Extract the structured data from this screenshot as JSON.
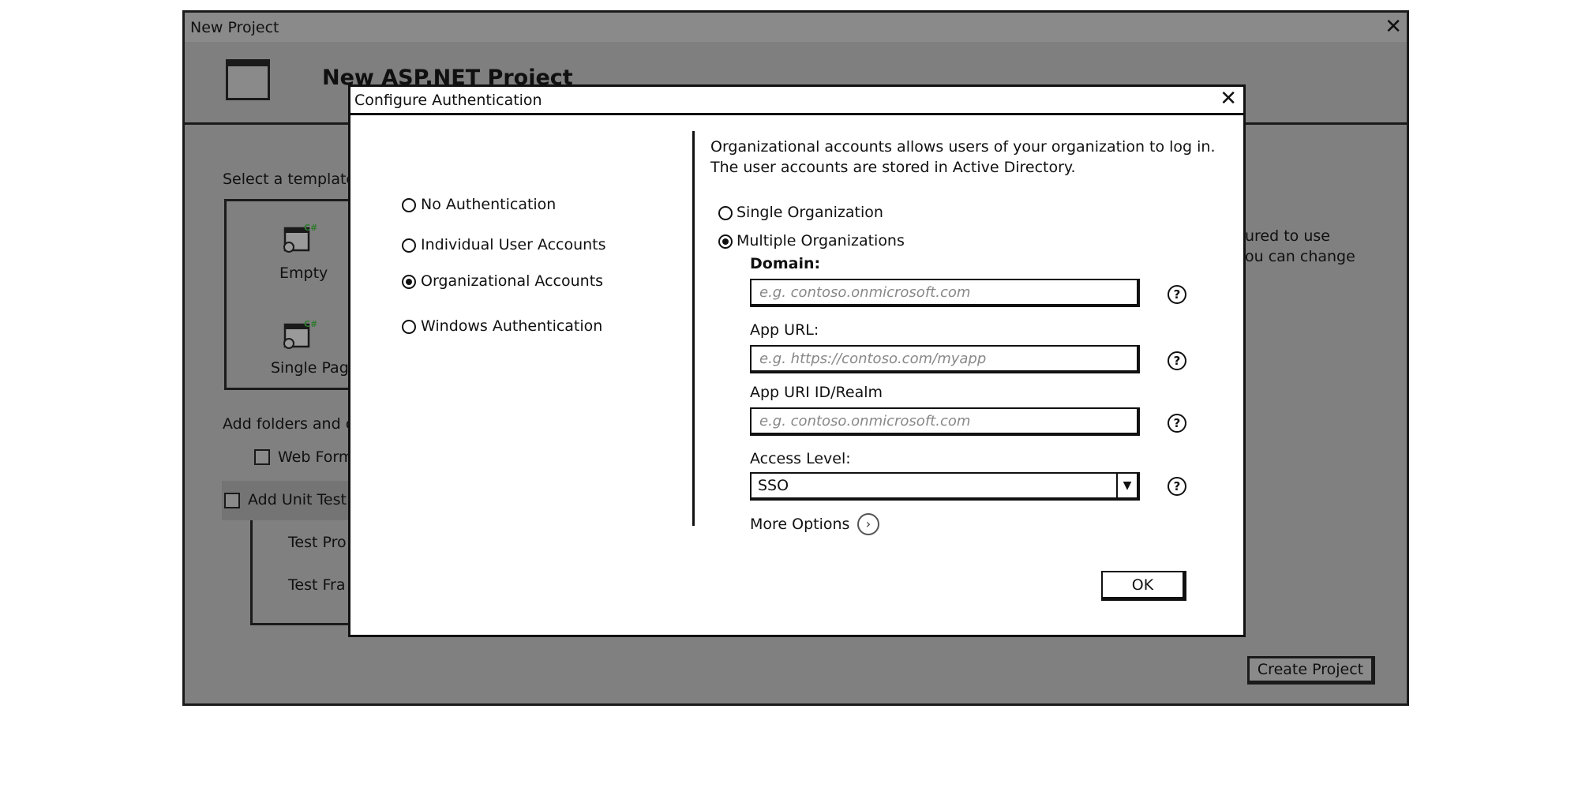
{
  "background_window": {
    "title": "New Project",
    "close_glyph": "✕",
    "header_title": "New ASP.NET Project",
    "select_template_label": "Select a template",
    "templates": [
      {
        "label": "Empty",
        "badge": "C#"
      },
      {
        "label": "Single Pag",
        "badge": "C#"
      }
    ],
    "add_folders_label": "Add folders and c",
    "web_forms_label": "Web Form",
    "add_unit_tests_label": "Add Unit Test",
    "test_project_label": "Test Pro",
    "test_framework_label": "Test Fra",
    "auth_note_line1": "ured to use",
    "auth_note_line2": "ou can change",
    "create_project_label": "Create Project"
  },
  "dialog": {
    "title": "Configure Authentication",
    "close_glyph": "✕",
    "auth_options": [
      {
        "label": "No Authentication",
        "selected": false
      },
      {
        "label": "Individual User Accounts",
        "selected": false
      },
      {
        "label": "Organizational Accounts",
        "selected": true
      },
      {
        "label": "Windows Authentication",
        "selected": false
      }
    ],
    "description_line1": "Organizational accounts allows users of your organization to log in.",
    "description_line2": "The user accounts are stored in Active Directory.",
    "org_options": [
      {
        "label": "Single Organization",
        "selected": false
      },
      {
        "label": "Multiple Organizations",
        "selected": true
      }
    ],
    "domain": {
      "label": "Domain:",
      "placeholder": "e.g. contoso.onmicrosoft.com"
    },
    "app_url": {
      "label": "App URL:",
      "placeholder": "e.g. https://contoso.com/myapp"
    },
    "app_uri": {
      "label": "App URI ID/Realm",
      "placeholder": "e.g. contoso.onmicrosoft.com"
    },
    "access_level": {
      "label": "Access Level:",
      "value": "SSO"
    },
    "help_glyph": "?",
    "more_options_label": "More Options",
    "ok_label": "OK"
  }
}
